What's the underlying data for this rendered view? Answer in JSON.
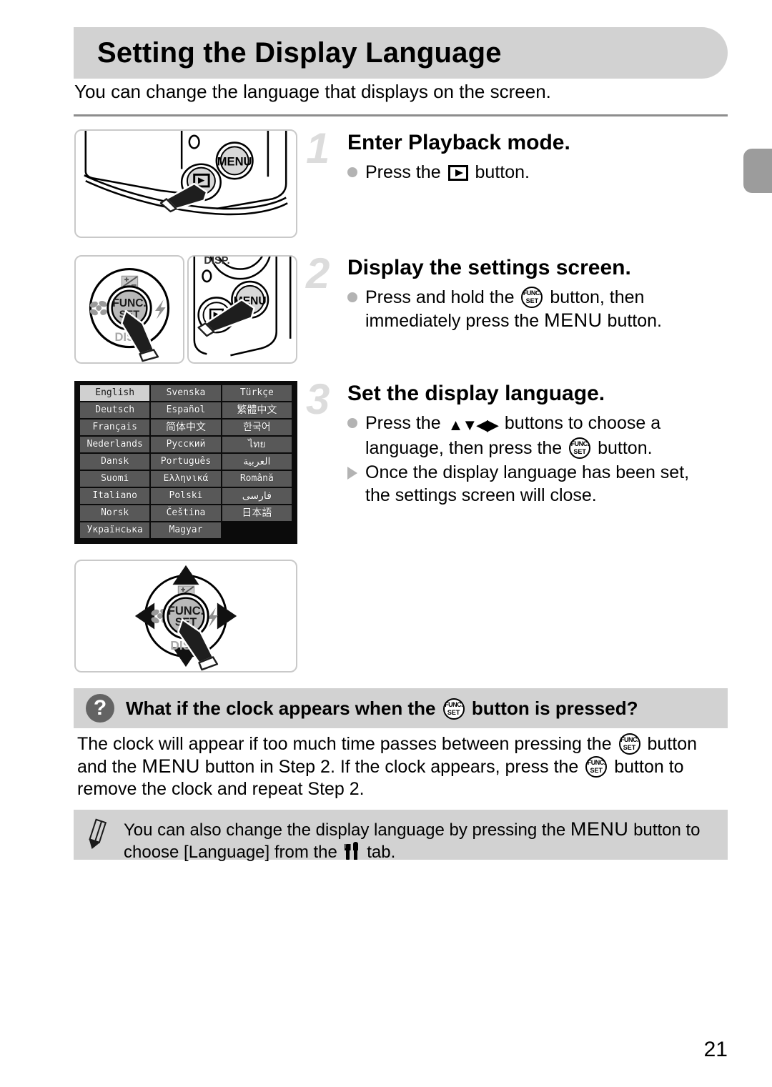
{
  "page": {
    "title": "Setting the Display Language",
    "intro": "You can change the language that displays on the screen.",
    "page_number": "21",
    "colors": {
      "header_bar": "#d2d2d2",
      "edge_tab": "#9c9c9c",
      "step_number": "#dcdcdc",
      "bullet": "#b3b3b3",
      "qa_icon": "#636363",
      "screen_background": "#0b0b0b",
      "language_cell": "#585858",
      "language_cell_selected": "#d0d0d0"
    }
  },
  "steps": [
    {
      "number": "1",
      "heading": "Enter Playback mode.",
      "lines": [
        {
          "marker": "dot",
          "parts": [
            {
              "type": "text",
              "value": "Press the "
            },
            {
              "type": "icon",
              "value": "playback-button-icon"
            },
            {
              "type": "text",
              "value": " button."
            }
          ],
          "plain": "Press the [playback] button."
        }
      ],
      "figure": {
        "name": "camera-back-corner-playback-button",
        "labels": [
          "MENU"
        ]
      }
    },
    {
      "number": "2",
      "heading": "Display the settings screen.",
      "lines": [
        {
          "marker": "dot",
          "parts": [
            {
              "type": "text",
              "value": "Press and hold the "
            },
            {
              "type": "icon",
              "value": "func-set-button-icon"
            },
            {
              "type": "text",
              "value": " button, then"
            }
          ],
          "plain": "Press and hold the [FUNC./SET] button, then"
        },
        {
          "marker": "none",
          "parts": [
            {
              "type": "text",
              "value": "immediately press the "
            },
            {
              "type": "icon",
              "value": "menu-button-icon"
            },
            {
              "type": "text",
              "value": " button."
            }
          ],
          "plain": "immediately press the MENU button."
        }
      ],
      "figures": [
        {
          "name": "control-dial-func-set",
          "labels": [
            "FUNC.",
            "SET",
            "DISP."
          ],
          "icons": [
            "exposure-compensation-icon",
            "macro-icon",
            "flash-icon"
          ]
        },
        {
          "name": "camera-back-menu-button",
          "labels": [
            "DISP.",
            "MENU"
          ]
        }
      ]
    },
    {
      "number": "3",
      "heading": "Set the display language.",
      "lines": [
        {
          "marker": "dot",
          "parts": [
            {
              "type": "text",
              "value": "Press the "
            },
            {
              "type": "icon",
              "value": "updown-leftright-arrows-icon"
            },
            {
              "type": "text",
              "value": " buttons to choose a"
            }
          ],
          "plain": "Press the up/down/left/right buttons to choose a"
        },
        {
          "marker": "none",
          "parts": [
            {
              "type": "text",
              "value": "language, then press the "
            },
            {
              "type": "icon",
              "value": "func-set-button-icon"
            },
            {
              "type": "text",
              "value": " button."
            }
          ],
          "plain": "language, then press the [FUNC./SET] button."
        },
        {
          "marker": "triangle",
          "parts": [
            {
              "type": "text",
              "value": "Once the display language has been set,"
            }
          ],
          "plain": "Once the display language has been set,"
        },
        {
          "marker": "none",
          "parts": [
            {
              "type": "text",
              "value": "the settings screen will close."
            }
          ],
          "plain": "the settings screen will close."
        }
      ],
      "figure": {
        "name": "control-dial-with-direction-arrows",
        "labels": [
          "FUNC.",
          "SET",
          "DISP."
        ]
      }
    }
  ],
  "language_screen": {
    "name": "language-selection-screen",
    "columns": 3,
    "rows": 9,
    "selected": "English",
    "cells": [
      [
        "English",
        "Svenska",
        "Türkçe"
      ],
      [
        "Deutsch",
        "Español",
        "繁體中文"
      ],
      [
        "Français",
        "简体中文",
        "한국어"
      ],
      [
        "Nederlands",
        "Русский",
        "ไทย"
      ],
      [
        "Dansk",
        "Português",
        "العربية"
      ],
      [
        "Suomi",
        "Ελληνικά",
        "Română"
      ],
      [
        "Italiano",
        "Polski",
        "فارسی"
      ],
      [
        "Norsk",
        "Čeština",
        "日本語"
      ],
      [
        "Українська",
        "Magyar",
        ""
      ]
    ]
  },
  "qa": {
    "icon": "question-mark-icon",
    "title_parts": [
      {
        "type": "text",
        "value": "What if the clock appears when the "
      },
      {
        "type": "icon",
        "value": "func-set-button-icon"
      },
      {
        "type": "text",
        "value": " button is pressed?"
      }
    ],
    "title_plain": "What if the clock appears when the [FUNC./SET] button is pressed?",
    "body_parts": [
      {
        "type": "text",
        "value": "The clock will appear if too much time passes between pressing the "
      },
      {
        "type": "icon",
        "value": "func-set-button-icon"
      },
      {
        "type": "text",
        "value": " button and the "
      },
      {
        "type": "icon",
        "value": "menu-button-icon"
      },
      {
        "type": "text",
        "value": " button in Step 2. If the clock appears, press the "
      },
      {
        "type": "icon",
        "value": "func-set-button-icon"
      },
      {
        "type": "text",
        "value": " button to remove the clock and repeat Step 2."
      }
    ],
    "body_plain": "The clock will appear if too much time passes between pressing the [FUNC./SET] button and the MENU button in Step 2. If the clock appears, press the [FUNC./SET] button to remove the clock and repeat Step 2."
  },
  "note": {
    "icon": "pencil-icon",
    "parts": [
      {
        "type": "text",
        "value": "You can also change the display language by pressing the "
      },
      {
        "type": "icon",
        "value": "menu-button-icon"
      },
      {
        "type": "text",
        "value": " button to choose [Language] from the "
      },
      {
        "type": "icon",
        "value": "settings-tab-icon"
      },
      {
        "type": "text",
        "value": " tab."
      }
    ],
    "plain": "You can also change the display language by pressing the MENU button to choose [Language] from the [tools] tab."
  }
}
